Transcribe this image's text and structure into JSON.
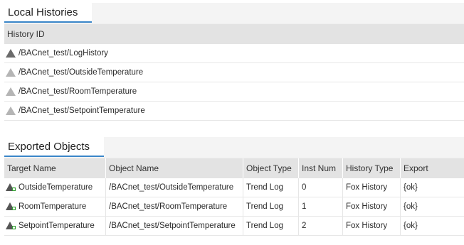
{
  "local_histories": {
    "tab_label": "Local Histories",
    "column_header": "History ID",
    "rows": [
      {
        "icon": "history-icon-dark",
        "id": "/BACnet_test/LogHistory"
      },
      {
        "icon": "history-icon-light",
        "id": "/BACnet_test/OutsideTemperature"
      },
      {
        "icon": "history-icon-light",
        "id": "/BACnet_test/RoomTemperature"
      },
      {
        "icon": "history-icon-light",
        "id": "/BACnet_test/SetpointTemperature"
      }
    ]
  },
  "exported_objects": {
    "tab_label": "Exported Objects",
    "columns": [
      "Target Name",
      "Object Name",
      "Object Type",
      "Inst Num",
      "History Type",
      "Export"
    ],
    "rows": [
      {
        "icon": "export-history-icon",
        "target": "OutsideTemperature",
        "object": "/BACnet_test/OutsideTemperature",
        "type": "Trend Log",
        "inst": "0",
        "htype": "Fox History",
        "export": "{ok}"
      },
      {
        "icon": "export-history-icon",
        "target": "RoomTemperature",
        "object": "/BACnet_test/RoomTemperature",
        "type": "Trend Log",
        "inst": "1",
        "htype": "Fox History",
        "export": "{ok}"
      },
      {
        "icon": "export-history-icon",
        "target": "SetpointTemperature",
        "object": "/BACnet_test/SetpointTemperature",
        "type": "Trend Log",
        "inst": "2",
        "htype": "Fox History",
        "export": "{ok}"
      }
    ]
  },
  "colors": {
    "accent": "#3a86c8",
    "header_bg": "#e3e3e3",
    "icon_dark": "#6b6b6b",
    "icon_light": "#b5b5b5",
    "icon_green": "#2e9b2e"
  }
}
